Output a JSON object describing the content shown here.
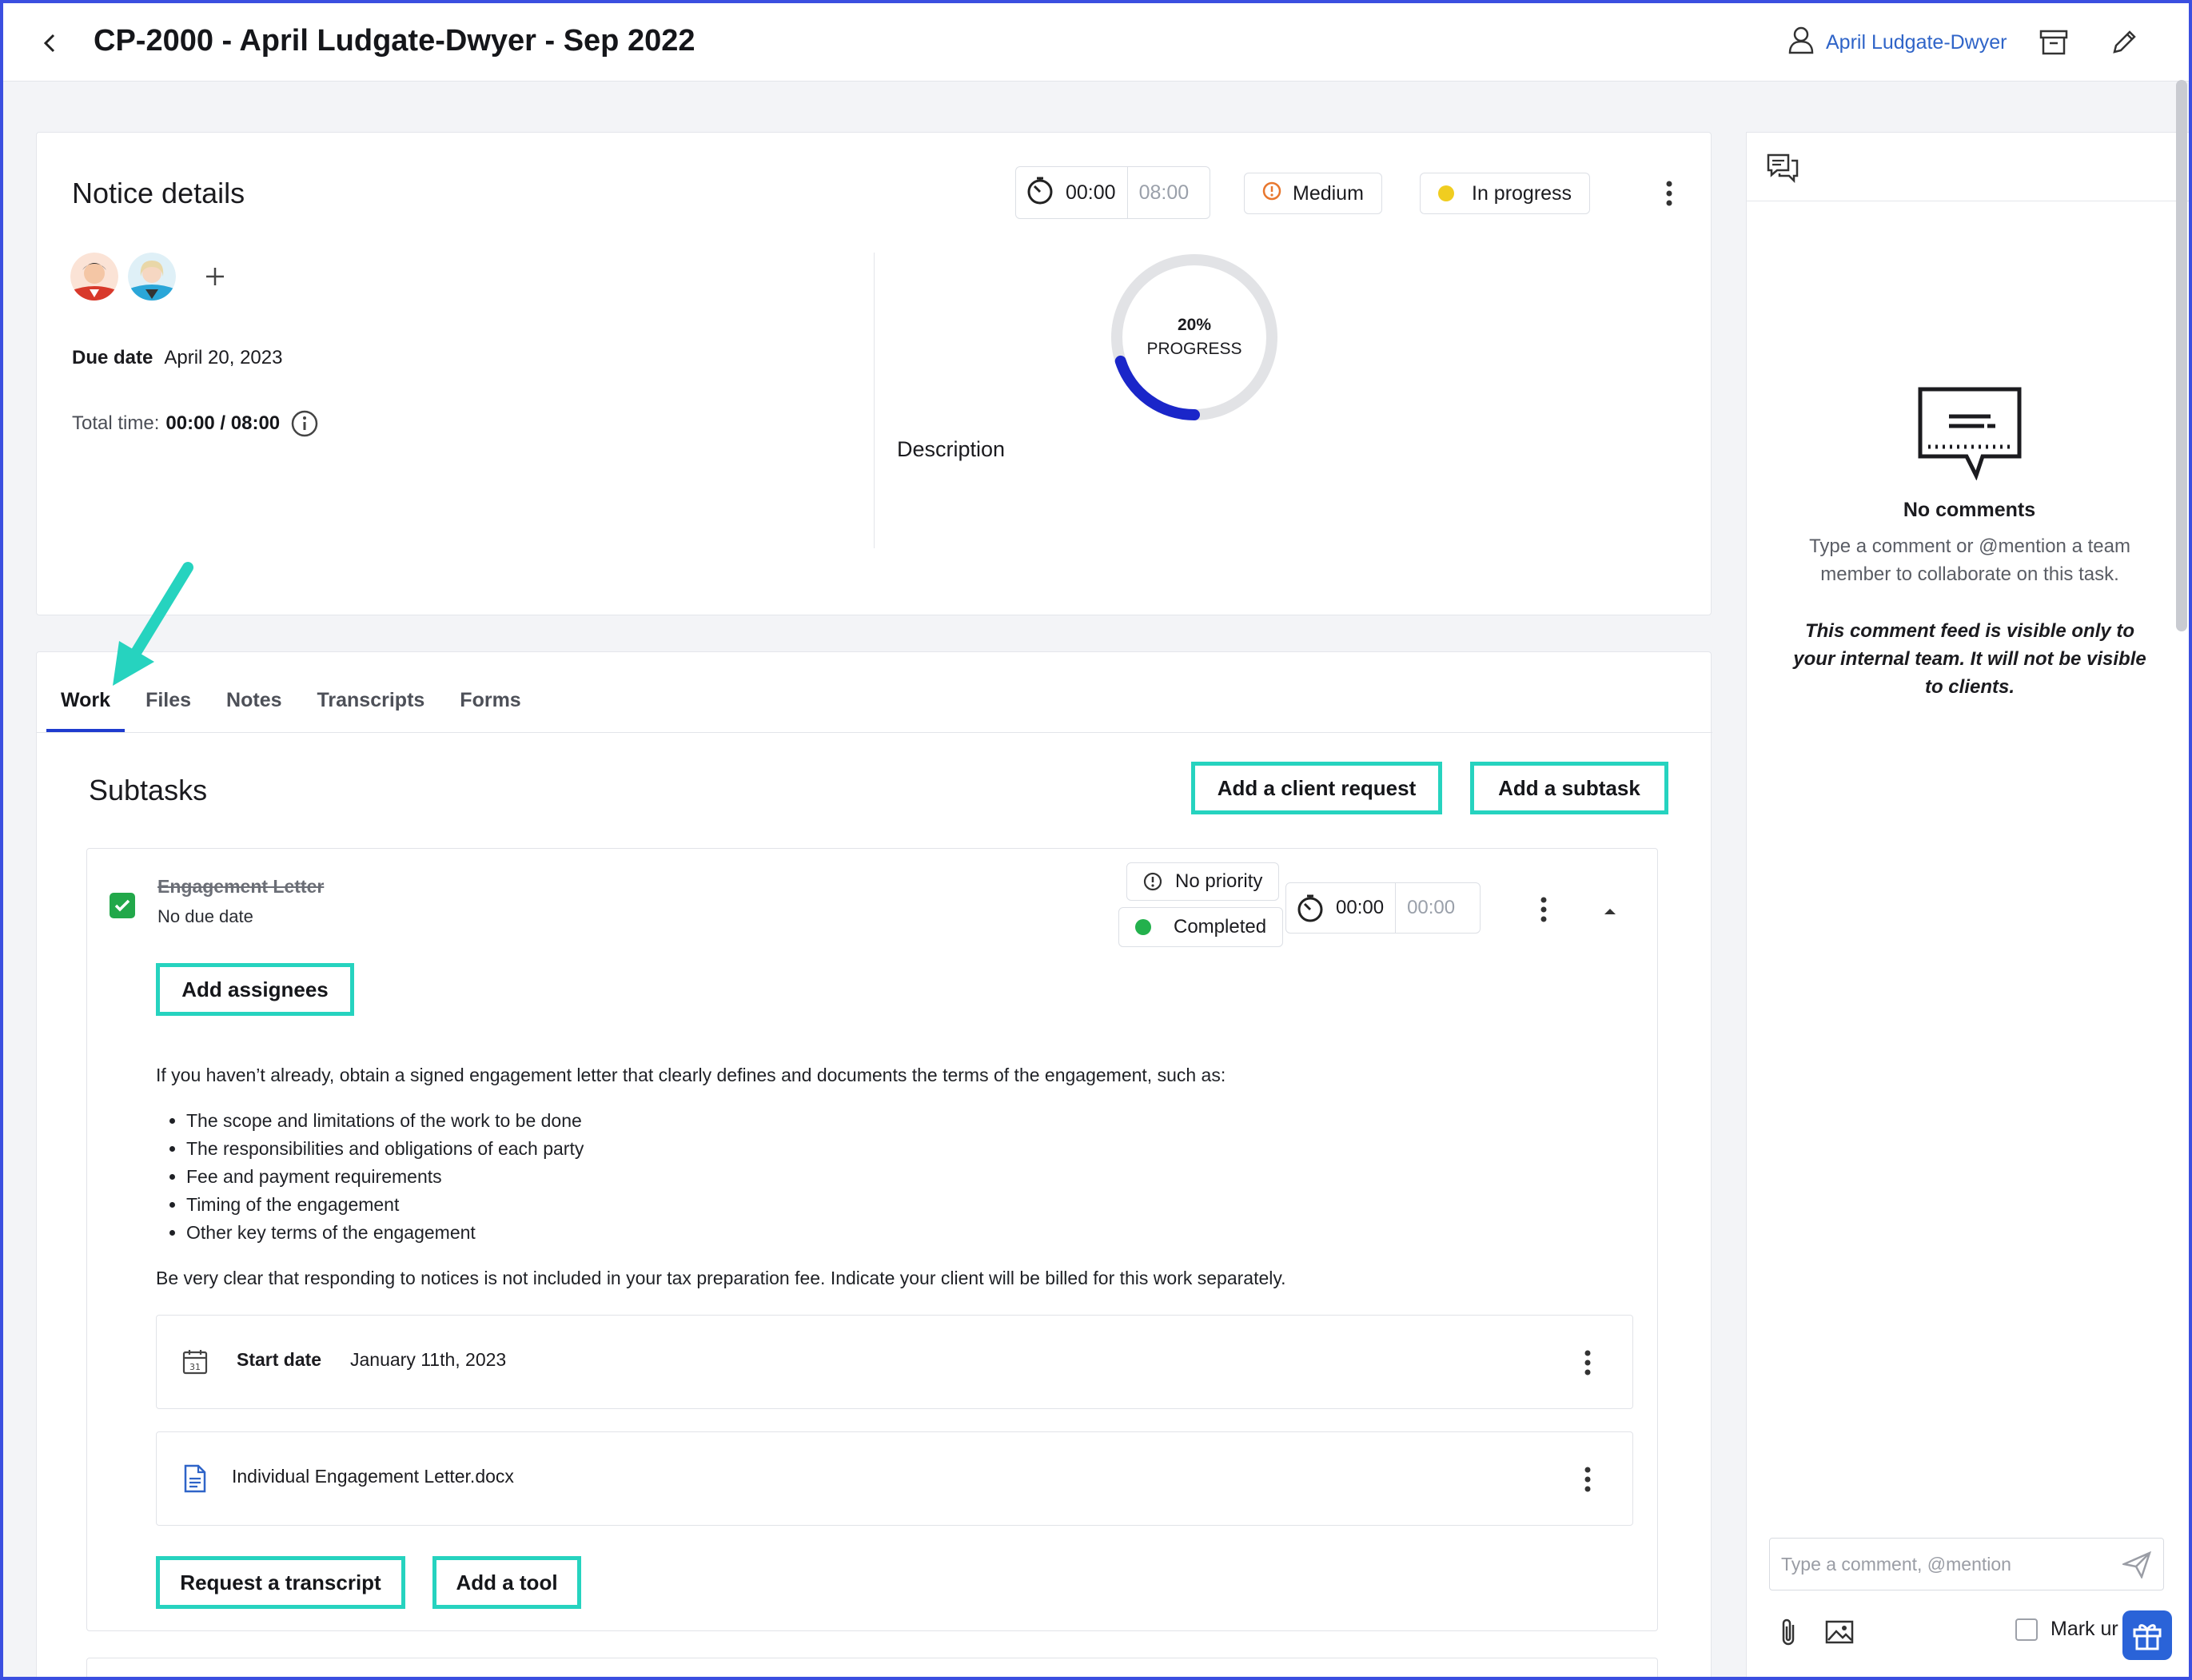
{
  "header": {
    "title": "CP-2000 - April Ludgate-Dwyer - Sep 2022",
    "client_name": "April Ludgate-Dwyer",
    "icons": [
      "back-chevron-icon",
      "user-icon",
      "archive-icon",
      "pencil-icon"
    ]
  },
  "notice": {
    "title": "Notice details",
    "timer": {
      "elapsed": "00:00",
      "budget": "08:00"
    },
    "priority": {
      "label": "Medium",
      "color": "#e8772e"
    },
    "status": {
      "label": "In progress",
      "color": "#f0cd20"
    },
    "due_label": "Due date",
    "due_value": "April 20, 2023",
    "total_time_label": "Total time:",
    "total_time_value": "00:00 / 08:00",
    "progress": {
      "percent": 20,
      "percent_text": "20%",
      "label": "PROGRESS",
      "color": "#1a26c9"
    },
    "description_label": "Description"
  },
  "tabs": [
    {
      "label": "Work",
      "active": true
    },
    {
      "label": "Files"
    },
    {
      "label": "Notes"
    },
    {
      "label": "Transcripts"
    },
    {
      "label": "Forms"
    }
  ],
  "work": {
    "subtasks_title": "Subtasks",
    "add_client_request": "Add a client request",
    "add_subtask": "Add a subtask",
    "subtask": {
      "name": "Engagement Letter",
      "due": "No due date",
      "completed": true,
      "priority": "No priority",
      "status": {
        "label": "Completed",
        "color": "#23b14d"
      },
      "timer": {
        "elapsed": "00:00",
        "budget": "00:00"
      },
      "add_assignees": "Add assignees",
      "intro": "If you haven’t already, obtain a signed engagement letter that clearly defines and documents the terms of the engagement, such as:",
      "bullets": [
        "The scope and limitations of the work to be done",
        "The responsibilities and obligations of each party",
        "Fee and payment requirements",
        "Timing of the engagement",
        "Other key terms of the engagement"
      ],
      "outro": "Be very clear that responding to notices is not included in your tax preparation fee. Indicate your client will be billed for this work separately.",
      "start_date_label": "Start date",
      "start_date_value": "January 11th, 2023",
      "calendar_day": "31",
      "file_name": "Individual Engagement Letter.docx",
      "request_transcript": "Request a transcript",
      "add_tool": "Add a tool"
    }
  },
  "comments": {
    "empty_title": "No comments",
    "empty_sub": "Type a comment or @mention a team member to collaborate on this task.",
    "visibility_note": "This comment feed is visible only to your internal team. It will not be visible to clients.",
    "input_placeholder": "Type a comment, @mention",
    "mark_unread": "Mark ur"
  },
  "accent": {
    "highlight": "#26d3bf",
    "tab_underline": "#1e3bcf",
    "link": "#2f64c8"
  }
}
